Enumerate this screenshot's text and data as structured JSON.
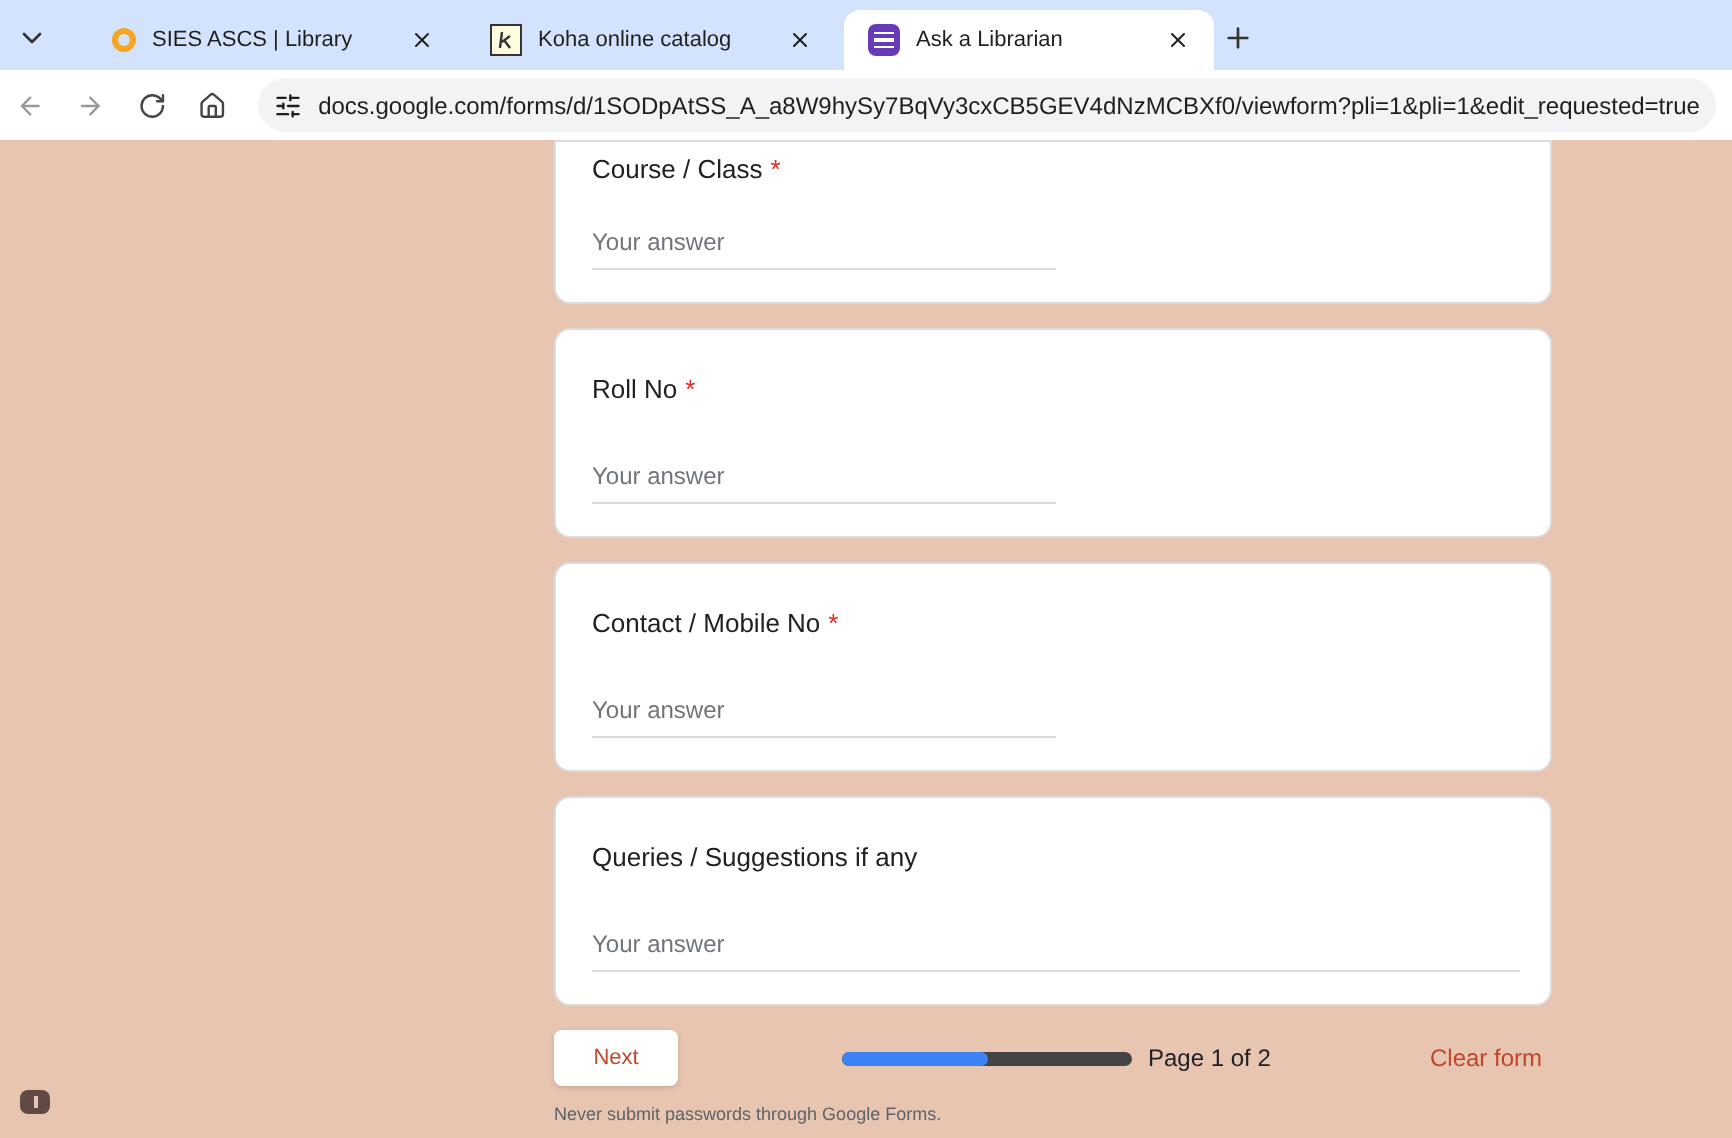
{
  "browser": {
    "tabs": [
      {
        "title": "SIES ASCS | Library",
        "kind": "circle",
        "selected": false
      },
      {
        "title": "Koha online catalog",
        "kind": "koha",
        "selected": false
      },
      {
        "title": "Ask a Librarian",
        "kind": "forms",
        "selected": true
      }
    ],
    "url": "docs.google.com/forms/d/1SODpAtSS_A_a8W9hySy7BqVy3cxCB5GEV4dNzMCBXf0/viewform?pli=1&pli=1&edit_requested=true"
  },
  "questions": [
    {
      "title": "Course / Class",
      "required_mark": "*",
      "kind": "short",
      "placeholder": "Your answer"
    },
    {
      "title": "Roll No",
      "required_mark": "*",
      "kind": "short",
      "placeholder": "Your answer"
    },
    {
      "title": "Contact / Mobile No",
      "required_mark": "*",
      "kind": "short",
      "placeholder": "Your answer"
    },
    {
      "title": "Queries / Suggestions if any",
      "kind": "paragraph",
      "placeholder": "Your answer"
    }
  ],
  "footer": {
    "next": "Next",
    "progress": {
      "level": 0.5
    },
    "page": "Page 1 of 2",
    "clear": "Clear form",
    "note": "Never submit passwords through Google Forms."
  }
}
